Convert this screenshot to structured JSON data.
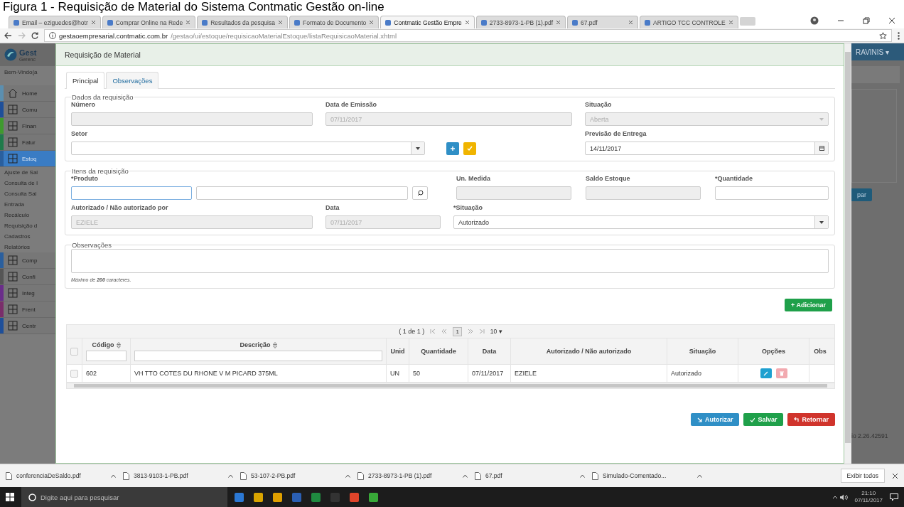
{
  "caption": "Figura 1 - Requisição de Material do Sistema Contmatic Gestão on-line",
  "browser": {
    "tabs": [
      {
        "title": "Email – eziguedes@hotr",
        "selected": false
      },
      {
        "title": "Comprar Online na Rede",
        "selected": false
      },
      {
        "title": "Resultados da pesquisa",
        "selected": false
      },
      {
        "title": "Formato de Documento",
        "selected": false
      },
      {
        "title": "Contmatic Gestão Empre",
        "selected": true
      },
      {
        "title": "2733-8973-1-PB (1).pdf",
        "selected": false
      },
      {
        "title": "67.pdf",
        "selected": false
      },
      {
        "title": "ARTIGO TCC CONTROLE",
        "selected": false
      }
    ],
    "url_host": "gestaoempresarial.contmatic.com.br",
    "url_path": "/gestao/ui/estoque/requisicaoMaterialEstoque/listaRequisicaoMaterial.xhtml"
  },
  "sidebar": {
    "logo_title": "Gest",
    "logo_sub": "Gerenc",
    "welcome": "Bem-Vindo(a",
    "modules": [
      {
        "label": "Home",
        "color": "#5b8fb0",
        "selected": false
      },
      {
        "label": "Comu",
        "color": "#1e4f9a",
        "selected": false
      },
      {
        "label": "Finan",
        "color": "#3f9a2e",
        "selected": false
      },
      {
        "label": "Fatur",
        "color": "#1f7a4a",
        "selected": false
      },
      {
        "label": "Estoq",
        "color": "#2a5f9e",
        "selected": true,
        "children": [
          {
            "label": "Ajuste de Sal"
          },
          {
            "label": "Consulta de I"
          },
          {
            "label": "Consulta Sal"
          },
          {
            "label": "Entrada"
          },
          {
            "label": "Recálculo"
          },
          {
            "label": "Requisição d"
          },
          {
            "label": "Cadastros"
          },
          {
            "label": "Relatórios"
          }
        ]
      },
      {
        "label": "Comp",
        "color": "#2a5f9e",
        "selected": false
      },
      {
        "label": "Confi",
        "color": "#555555",
        "selected": false
      },
      {
        "label": "Integ",
        "color": "#6a2d8a",
        "selected": false
      },
      {
        "label": "Frent",
        "color": "#7a2d6a",
        "selected": false
      },
      {
        "label": "Centr",
        "color": "#1e4f9a",
        "selected": false
      }
    ]
  },
  "background_right": {
    "user": "RAVINIS ▾",
    "button": "par",
    "version": "io 2.26.42591"
  },
  "modal": {
    "title": "Requisição de Material",
    "tabs": [
      {
        "label": "Principal",
        "selected": true
      },
      {
        "label": "Observações",
        "selected": false
      }
    ],
    "dados": {
      "legend": "Dados da requisição",
      "numero": {
        "label": "Número"
      },
      "emissao": {
        "label": "Data de Emissão",
        "value": "07/11/2017"
      },
      "situacao": {
        "label": "Situação",
        "value": "Aberta"
      },
      "setor": {
        "label": "Setor"
      },
      "previsao": {
        "label": "Previsão de Entrega",
        "value": "14/11/2017"
      }
    },
    "itens": {
      "legend": "Itens da requisição",
      "produto": {
        "label": "*Produto"
      },
      "medida": {
        "label": "Un. Medida"
      },
      "saldo": {
        "label": "Saldo Estoque"
      },
      "quantidade": {
        "label": "*Quantidade"
      },
      "autorizado": {
        "label": "Autorizado / Não autorizado por",
        "value": "EZIELE"
      },
      "data": {
        "label": "Data",
        "value": "07/11/2017"
      },
      "situacao": {
        "label": "*Situação",
        "value": "Autorizado"
      }
    },
    "obs": {
      "legend": "Observações",
      "hint": "Máximo de **200** caracteres."
    },
    "add_button": "+ Adicionar",
    "table": {
      "select_all_checked": false,
      "pager": "( 1 de 1 )",
      "page": "1",
      "per_page": "10 ▾",
      "columns": [
        {
          "label": "Código",
          "sortable": true,
          "filter": true
        },
        {
          "label": "Descrição",
          "sortable": true,
          "filter": true
        },
        {
          "label": "Unid",
          "sortable": false,
          "filter": false
        },
        {
          "label": "Quantidade",
          "sortable": false,
          "filter": false
        },
        {
          "label": "Data",
          "sortable": false,
          "filter": false
        },
        {
          "label": "Autorizado / Não autorizado",
          "sortable": false,
          "filter": false
        },
        {
          "label": "Situação",
          "sortable": false,
          "filter": false
        },
        {
          "label": "Opções",
          "sortable": false,
          "filter": false
        },
        {
          "label": "Obs",
          "sortable": false,
          "filter": false
        }
      ],
      "rows": [
        {
          "checked": false,
          "cells": [
            "602",
            "VH TTO COTES DU RHONE V M PICARD 375ML",
            "UN",
            "50",
            "07/11/2017",
            "EZIELE",
            "Autorizado"
          ]
        }
      ]
    },
    "actions": [
      {
        "label": "Autorizar",
        "kind": "primary"
      },
      {
        "label": "Salvar",
        "kind": "success"
      },
      {
        "label": "Retornar",
        "kind": "danger"
      }
    ]
  },
  "downloads": {
    "items": [
      "conferenciaDeSaldo.pdf",
      "3813-9103-1-PB.pdf",
      "53-107-2-PB.pdf",
      "2733-8973-1-PB (1).pdf",
      "67.pdf",
      "Simulado-Comentado..."
    ],
    "show_all": "Exibir todos"
  },
  "taskbar": {
    "search": "Digite aqui para pesquisar",
    "time": "21:10",
    "date": "07/11/2017"
  }
}
